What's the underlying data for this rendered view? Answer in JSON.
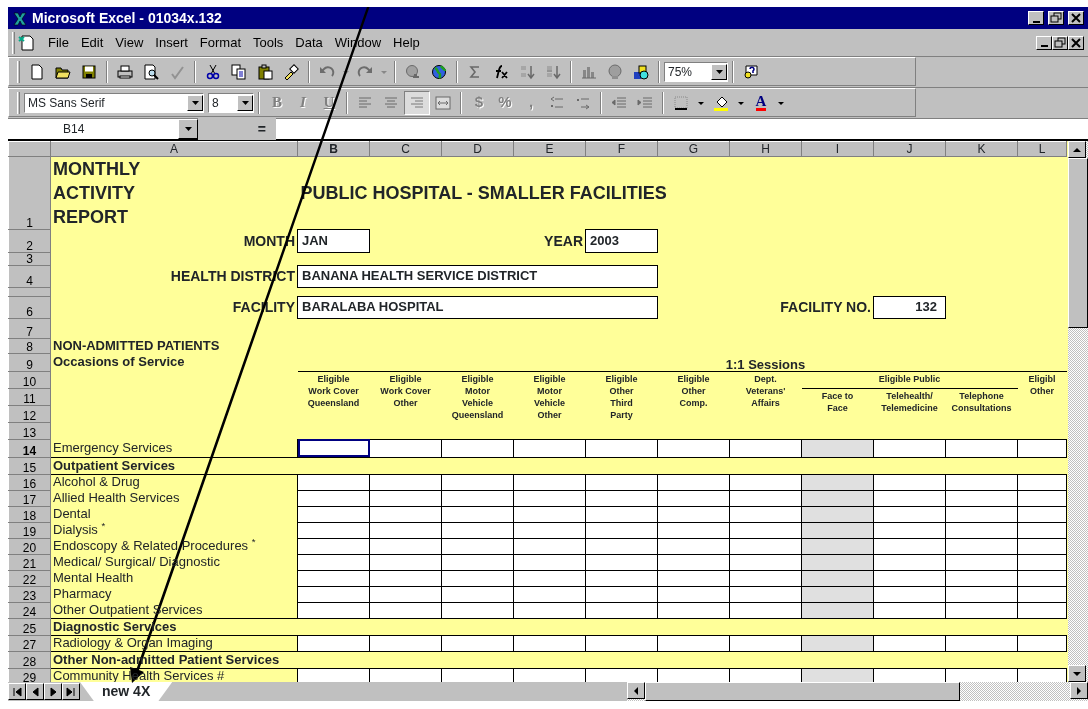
{
  "window": {
    "title": "Microsoft Excel - 01034x.132"
  },
  "menu": [
    "File",
    "Edit",
    "View",
    "Insert",
    "Format",
    "Tools",
    "Data",
    "Window",
    "Help"
  ],
  "standard_toolbar": {
    "buttons": [
      {
        "disabled": false
      },
      {
        "disabled": false
      },
      {
        "disabled": false
      },
      {
        "disabled": false
      },
      {
        "disabled": false
      },
      {
        "disabled": true
      },
      {
        "disabled": false
      },
      {
        "disabled": false
      },
      {
        "disabled": false
      },
      {
        "disabled": false
      },
      {
        "disabled": true
      },
      {
        "disabled": true
      },
      {
        "disabled": true
      },
      {
        "disabled": false
      },
      {
        "disabled": true
      },
      {
        "disabled": false
      },
      {
        "disabled": true
      },
      {
        "disabled": true
      },
      {
        "disabled": true
      },
      {
        "disabled": true
      },
      {
        "disabled": false
      },
      {
        "disabled": false
      }
    ],
    "zoom": "75%"
  },
  "formatting_toolbar": {
    "font": "MS Sans Serif",
    "size": "8",
    "buttons": [
      {
        "label": "B",
        "disabled": true,
        "pressed": false
      },
      {
        "label": "I",
        "disabled": true,
        "pressed": false
      },
      {
        "label": "U",
        "disabled": true,
        "pressed": false
      },
      {
        "disabled": true,
        "pressed": false
      },
      {
        "disabled": true,
        "pressed": false
      },
      {
        "disabled": true,
        "pressed": true
      },
      {
        "disabled": true,
        "pressed": false
      },
      {
        "label": "$",
        "disabled": true,
        "pressed": false
      },
      {
        "label": "%",
        "disabled": true,
        "pressed": false
      },
      {
        "label": ",",
        "disabled": true,
        "pressed": false
      },
      {
        "disabled": true,
        "pressed": false
      },
      {
        "disabled": true,
        "pressed": false
      },
      {
        "disabled": true,
        "pressed": false
      },
      {
        "disabled": true,
        "pressed": false
      },
      {
        "disabled": false,
        "pressed": false
      },
      {
        "disabled": false,
        "pressed": false
      },
      {
        "label": "A",
        "disabled": false,
        "pressed": false
      }
    ]
  },
  "formula_bar": {
    "name_box": "B14",
    "equals": "="
  },
  "sheet": {
    "columns": [
      {
        "letter": "A",
        "selected": false
      },
      {
        "letter": "B",
        "selected": true
      },
      {
        "letter": "C",
        "selected": false
      },
      {
        "letter": "D",
        "selected": false
      },
      {
        "letter": "E",
        "selected": false
      },
      {
        "letter": "F",
        "selected": false
      },
      {
        "letter": "G",
        "selected": false
      },
      {
        "letter": "H",
        "selected": false
      },
      {
        "letter": "I",
        "selected": false
      },
      {
        "letter": "J",
        "selected": false
      },
      {
        "letter": "K",
        "selected": false
      },
      {
        "letter": "L",
        "selected": false
      }
    ],
    "top_row_numbers": [
      "1",
      "2",
      "3",
      "4",
      "6",
      "7",
      "8",
      "9",
      "10",
      "11",
      "12",
      "13"
    ],
    "title_lines": [
      "MONTHLY",
      "ACTIVITY",
      "REPORT"
    ],
    "heading": "PUBLIC HOSPITAL - SMALLER FACILITIES",
    "month_label": "MONTH",
    "month": "JAN",
    "year_label": "YEAR",
    "year": "2003",
    "district_label": "HEALTH DISTRICT",
    "district": "BANANA HEALTH SERVICE DISTRICT",
    "facility_label": "FACILITY",
    "facility": "BARALABA HOSPITAL",
    "facility_no_label": "FACILITY NO.",
    "facility_no": "132",
    "section": "NON-ADMITTED PATIENTS",
    "subsection": "Occasions of Service",
    "sessions_header": "1:1 Sessions",
    "group_header": "Eligible Public",
    "data_columns": [
      {
        "header": "Eligible\nWork Cover\nQueensland",
        "grouped": false,
        "shaded": false
      },
      {
        "header": "Eligible\nWork Cover\nOther",
        "grouped": false,
        "shaded": false
      },
      {
        "header": "Eligible\nMotor\nVehicle\nQueensland",
        "grouped": false,
        "shaded": false
      },
      {
        "header": "Eligible\nMotor\nVehicle\nOther",
        "grouped": false,
        "shaded": false
      },
      {
        "header": "Eligible\nOther\nThird\nParty",
        "grouped": false,
        "shaded": false
      },
      {
        "header": "Eligible\nOther\nComp.",
        "grouped": false,
        "shaded": false
      },
      {
        "header": "Dept.\nVeterans'\nAffairs",
        "grouped": false,
        "shaded": false
      },
      {
        "header": "Face to\nFace",
        "grouped": true,
        "shaded": true
      },
      {
        "header": "Telehealth/\nTelemedicine",
        "grouped": true,
        "shaded": false
      },
      {
        "header": "Telephone\nConsultations",
        "grouped": true,
        "shaded": false
      },
      {
        "header": "Eligibl\nOther",
        "grouped": false,
        "shaded": false
      }
    ],
    "rows": [
      {
        "number": "14",
        "label": "Emergency Services",
        "kind": "data",
        "selected": true
      },
      {
        "number": "15",
        "label": "Outpatient Services",
        "kind": "section",
        "selected": false
      },
      {
        "number": "16",
        "label": "Alcohol & Drug",
        "kind": "data",
        "selected": false
      },
      {
        "number": "17",
        "label": "Allied Health Services",
        "kind": "data",
        "selected": false
      },
      {
        "number": "18",
        "label": "Dental",
        "kind": "data",
        "selected": false
      },
      {
        "number": "19",
        "label": "Dialysis $^{*}$",
        "kind": "data",
        "selected": false
      },
      {
        "number": "20",
        "label": "Endoscopy & Related Procedures $^{*}$",
        "kind": "data",
        "selected": false
      },
      {
        "number": "21",
        "label": "Medical/ Surgical/ Diagnostic",
        "kind": "data",
        "selected": false
      },
      {
        "number": "22",
        "label": "Mental Health",
        "kind": "data",
        "selected": false
      },
      {
        "number": "23",
        "label": "Pharmacy",
        "kind": "data",
        "selected": false
      },
      {
        "number": "24",
        "label": "Other Outpatient Services",
        "kind": "data",
        "selected": false
      },
      {
        "number": "25",
        "label": "Diagnostic Services",
        "kind": "section",
        "selected": false
      },
      {
        "number": "27",
        "label": "Radiology & Organ Imaging",
        "kind": "data",
        "selected": false
      },
      {
        "number": "28",
        "label": "Other Non-admitted Patient Services",
        "kind": "section",
        "selected": false
      },
      {
        "number": "29",
        "label": "Community Health Services #",
        "kind": "data",
        "selected": false
      }
    ]
  },
  "sheet_tabs": [
    {
      "label": "new 4X",
      "selected": true
    }
  ]
}
